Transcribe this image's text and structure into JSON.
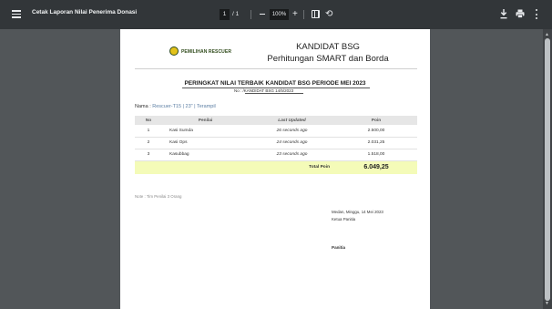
{
  "toolbar": {
    "title": "Cetak Laporan Nilai Penerima Donasi",
    "page_current": "1",
    "page_total": "/ 1",
    "zoom": "100%",
    "icons": [
      "menu-icon",
      "zoom-out-icon",
      "zoom-in-icon",
      "fit-page-icon",
      "rotate-icon",
      "download-icon",
      "print-icon",
      "more-icon"
    ]
  },
  "report": {
    "logo_text": "PEMILIHAN RESCUER",
    "title": "KANDIDAT BSG",
    "subtitle": "Perhitungan SMART dan Borda",
    "main_title": "PERINGKAT NILAI TERBAIK KANDIDAT BSG PERIODE MEI 2023",
    "doc_no": "No :  /KANDIDAT BSG 14/5/2023",
    "name_label": "Nama : ",
    "name_value": "Rescuer-T15 | 23\" | Terampil",
    "table": {
      "headers": [
        "No",
        "Penilai",
        "Last Updated",
        "Poin"
      ],
      "rows": [
        {
          "no": "1",
          "penilai": "Kasi Sumda",
          "updated": "26 seconds ago",
          "poin": "2.500,00"
        },
        {
          "no": "2",
          "penilai": "Kasi Ops",
          "updated": "24 seconds ago",
          "poin": "2.031,25"
        },
        {
          "no": "3",
          "penilai": "Kasubbag",
          "updated": "23 seconds ago",
          "poin": "1.518,00"
        }
      ],
      "total_label": "Total Poin",
      "total_value": "6.049,25"
    },
    "note": "Note : Tim Penilai 3 Orang",
    "sign_date": "Medan,   Minggu, 14 Mei 2023",
    "sign_role": "Ketua Panitia",
    "sign_name": "Panitia"
  },
  "colors": {
    "toolbar_bg": "#323639",
    "viewer_bg": "#525659",
    "total_row_bg": "#f4fbb8",
    "name_value": "#5b7ea3"
  }
}
